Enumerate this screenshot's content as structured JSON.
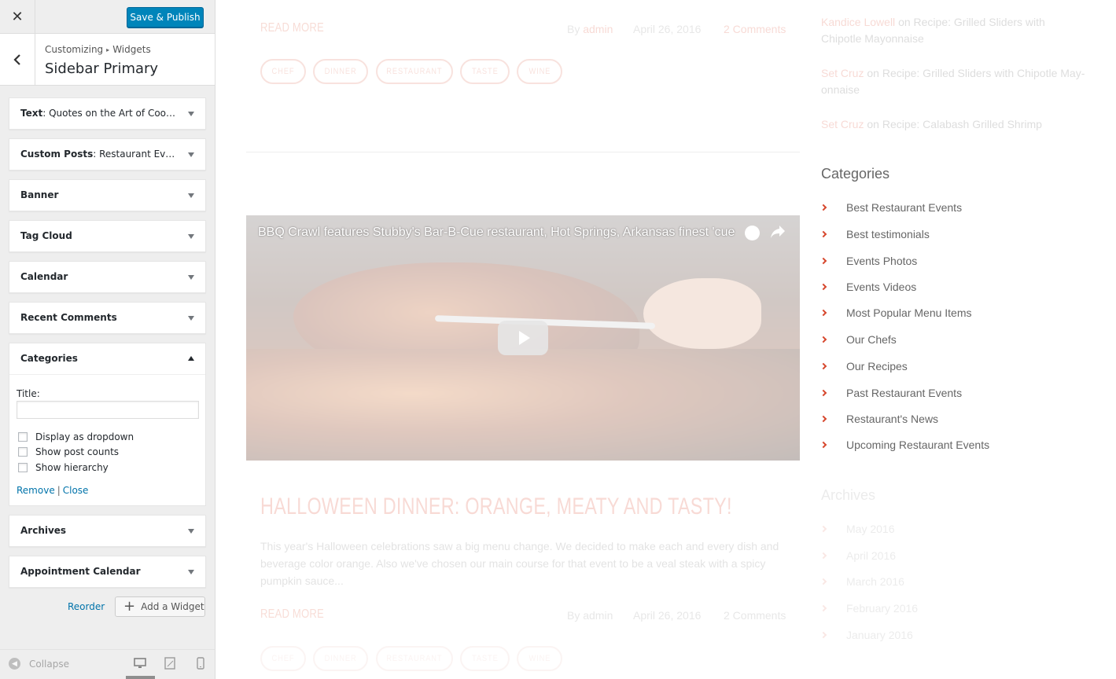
{
  "customizer": {
    "close_icon": "close-icon",
    "save_label": "Save & Publish",
    "breadcrumb": {
      "root": "Customizing",
      "section": "Widgets"
    },
    "title": "Sidebar Primary",
    "widgets": [
      {
        "type": "Text",
        "name": "Quotes on the Art of Cook..."
      },
      {
        "type": "Custom Posts",
        "name": "Restaurant Events"
      },
      {
        "type": "Banner",
        "name": ""
      },
      {
        "type": "Tag Cloud",
        "name": ""
      },
      {
        "type": "Calendar",
        "name": ""
      },
      {
        "type": "Recent Comments",
        "name": ""
      }
    ],
    "categories_widget": {
      "header": "Categories",
      "title_label": "Title:",
      "title_value": "",
      "options": [
        "Display as dropdown",
        "Show post counts",
        "Show hierarchy"
      ],
      "remove_label": "Remove",
      "close_label": "Close"
    },
    "widgets_after": [
      {
        "type": "Archives"
      },
      {
        "type": "Appointment Calendar"
      }
    ],
    "reorder_label": "Reorder",
    "add_widget_label": "Add a Widget",
    "collapse_label": "Collapse",
    "accent_color": "#0085ba"
  },
  "preview": {
    "post1": {
      "read_more": "READ MORE",
      "by": "By",
      "author": "admin",
      "date": "April 26, 2016",
      "comments": "2 Comments",
      "tags": [
        "CHEF",
        "DINNER",
        "RESTAURANT",
        "TASTE",
        "WINE"
      ]
    },
    "video": {
      "title": "BBQ Crawl features Stubby's Bar-B-Cue restaurant, Hot Springs, Arkansas finest 'cue"
    },
    "post2": {
      "title": "HALLOWEEN DINNER: ORANGE, MEATY AND TASTY!",
      "excerpt": "This year's Halloween celebrations saw a big menu change. We decided to make each and every dish and beverage color orange. Also we've chosen our main course for that event to be a veal steak with a spicy pumpkin sauce...",
      "read_more": "READ MORE",
      "by": "By",
      "author": "admin",
      "date": "April 26, 2016",
      "comments": "2 Comments",
      "tags": [
        "CHEF",
        "DINNER",
        "RESTAURANT",
        "TASTE",
        "WINE"
      ]
    },
    "recent_comments": [
      {
        "author": "Kandice Lowell",
        "on": "on",
        "post": "Recipe: Grilled Sliders with Chipotle Mayonnaise"
      },
      {
        "author": "Set Cruz",
        "on": "on",
        "post": "Recipe: Grilled Sliders with Chipotle May-onnaise"
      },
      {
        "author": "Set Cruz",
        "on": "on",
        "post": "Recipe: Calabash Grilled Shrimp"
      }
    ],
    "categories_heading": "Categories",
    "categories": [
      "Best Restaurant Events",
      "Best testimonials",
      "Events Photos",
      "Events Videos",
      "Most Popular Menu Items",
      "Our Chefs",
      "Our Recipes",
      "Past Restaurant Events",
      "Restaurant's News",
      "Upcoming Restaurant Events"
    ],
    "archives_heading": "Archives",
    "archives": [
      "May 2016",
      "April 2016",
      "March 2016",
      "February 2016",
      "January 2016"
    ],
    "accent_color": "#e57c6a"
  }
}
